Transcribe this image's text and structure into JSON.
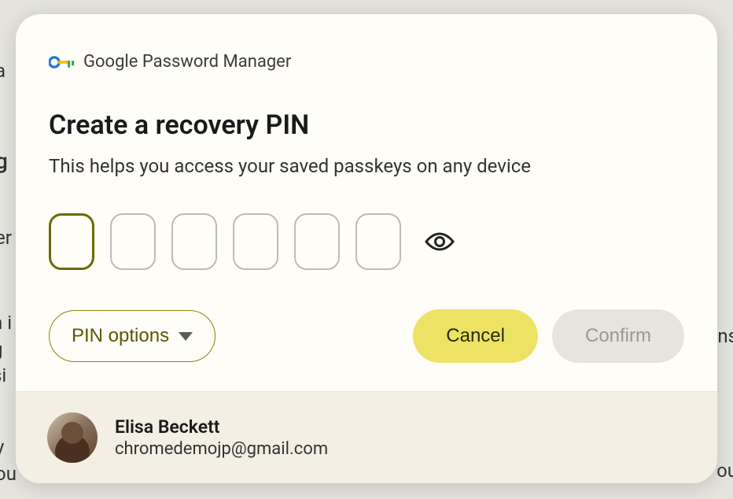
{
  "app": {
    "title": "Google Password Manager"
  },
  "dialog": {
    "title": "Create a recovery PIN",
    "subtitle": "This helps you access your saved passkeys on any device"
  },
  "pin": {
    "length": 6,
    "active_index": 0,
    "values": [
      "",
      "",
      "",
      "",
      "",
      ""
    ]
  },
  "actions": {
    "pin_options_label": "PIN options",
    "cancel_label": "Cancel",
    "confirm_label": "Confirm",
    "confirm_disabled": true
  },
  "user": {
    "name": "Elisa Beckett",
    "email": "chromedemojp@gmail.com"
  },
  "colors": {
    "accent_yellow": "#eee264",
    "outline_olive": "#8a8700",
    "focus_olive": "#6b6b00",
    "footer_bg": "#f3efe3"
  }
}
